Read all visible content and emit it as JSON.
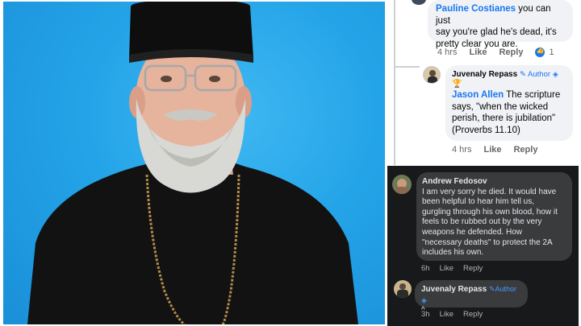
{
  "photo": {
    "alt": "portrait"
  },
  "light_thread": {
    "top_comment": {
      "author": "Pauline Costianes",
      "text_line1": " you can just",
      "text_line2": "say you're glad he's dead, it's",
      "text_line3": "pretty clear you are.",
      "time": "4 hrs",
      "like": "Like",
      "reply": "Reply",
      "reactions": "1"
    },
    "reply_comment": {
      "author": "Juvenaly Repass",
      "author_badge": "Author",
      "mention": "Jason Allen",
      "text_line1": " The scripture",
      "text_line2": "says, \"when the wicked",
      "text_line3": "perish, there is jubilation\"",
      "text_line4": "(Proverbs 11.10)",
      "time": "4 hrs",
      "like": "Like",
      "reply": "Reply"
    }
  },
  "dark_thread": {
    "comment": {
      "author": "Andrew Fedosov",
      "lines": [
        "I am very sorry he died. It would have",
        "been helpful to hear him tell us,",
        "gurgling through his own blood, how it",
        "feels to be rubbed out by the very",
        "weapons he defended. How",
        "\"necessary deaths\" to protect the 2A",
        "includes his own."
      ],
      "time": "6h",
      "like": "Like",
      "reply": "Reply"
    },
    "reply": {
      "author": "Juvenaly Repass",
      "author_badge": "Author",
      "text": "^",
      "time": "3h",
      "like": "Like",
      "reply": "Reply"
    }
  },
  "colors": {
    "photo_background": "#24a4e8",
    "link_blue": "#1877f2",
    "dark_bg": "#18191a",
    "dark_bubble": "#3a3b3c"
  }
}
